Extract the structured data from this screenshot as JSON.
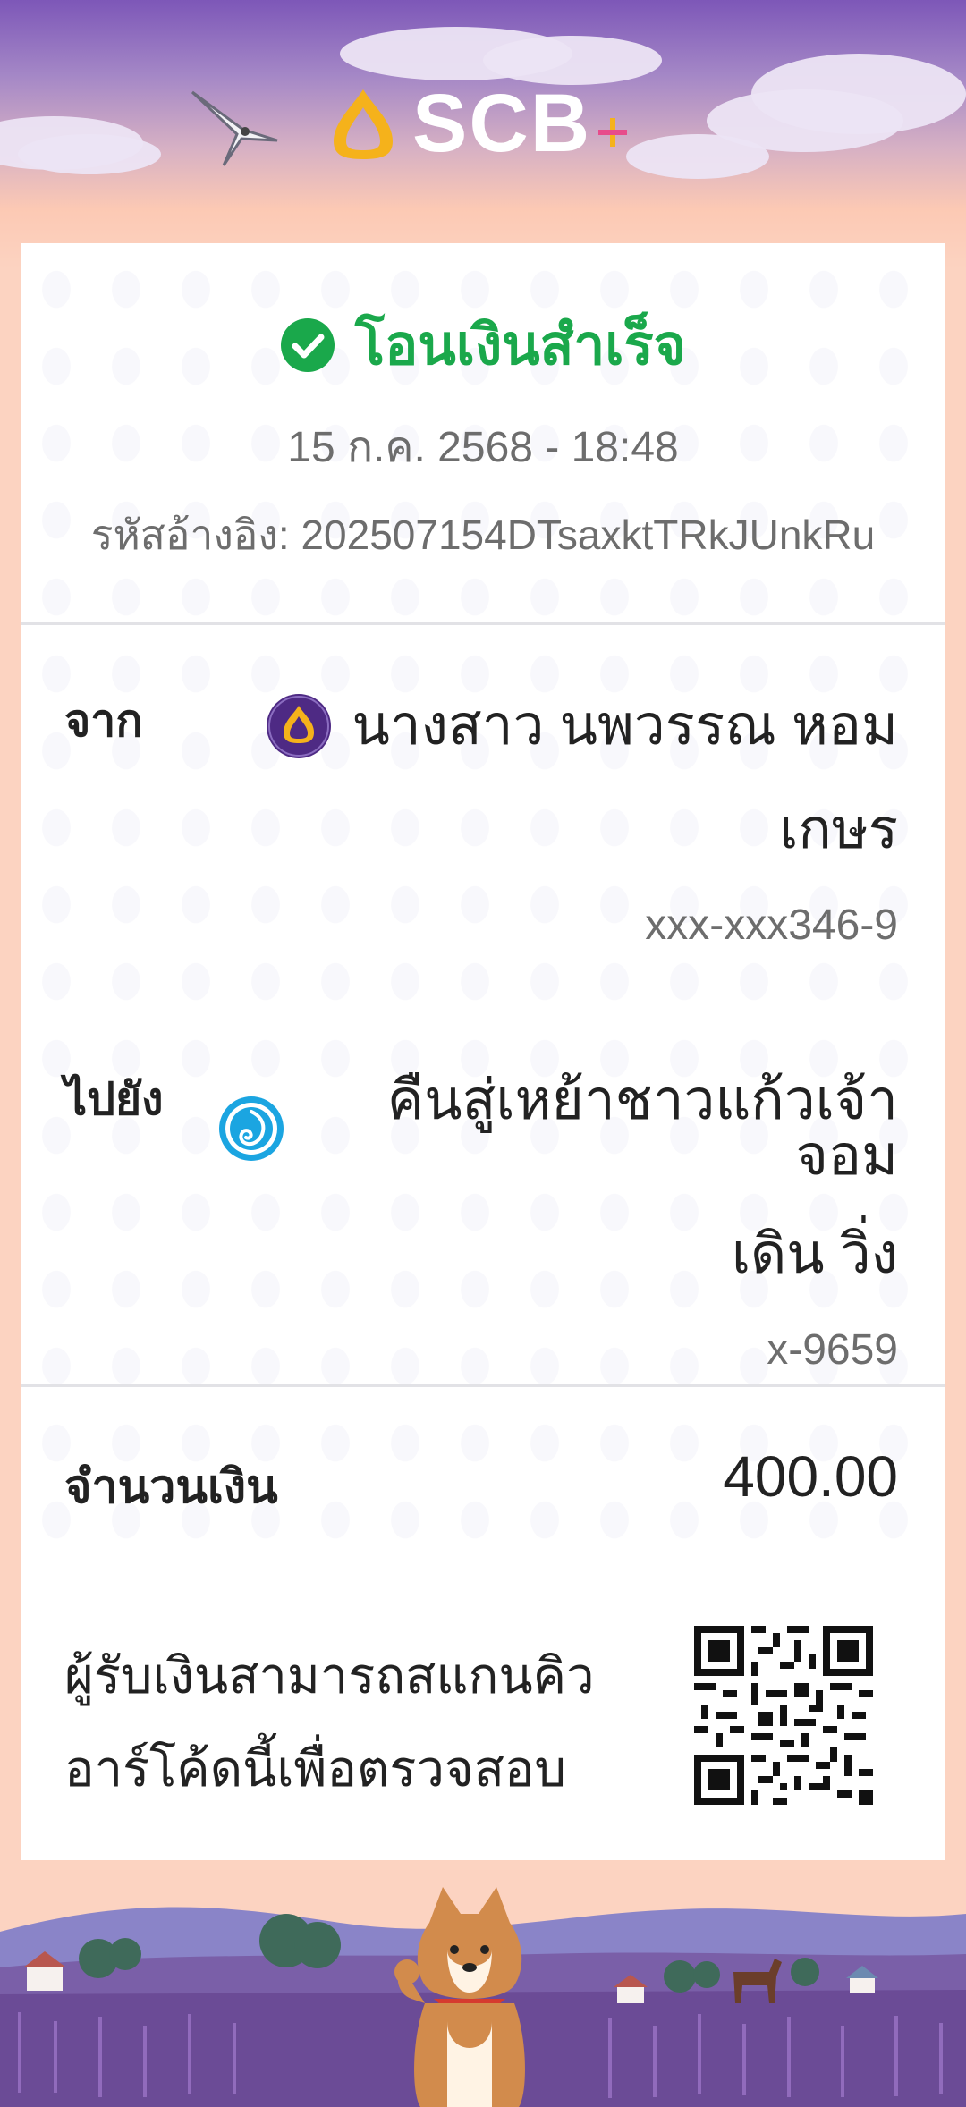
{
  "header": {
    "brand": "SCB"
  },
  "receipt": {
    "status": "โอนเงินสำเร็จ",
    "datetime": "15 ก.ค. 2568 - 18:48",
    "ref_label": "รหัสอ้างอิง:",
    "ref_value": "202507154DTsaxktTRkJUnkRu"
  },
  "from": {
    "label": "จาก",
    "name_line1": "นางสาว นพวรรณ หอม",
    "name_line2": "เกษร",
    "account": "xxx-xxx346-9",
    "bank_icon": "scb-bank-icon"
  },
  "to": {
    "label": "ไปยัง",
    "name_line1": "คืนสู่เหย้าชาวแก้วเจ้าจอม",
    "name_line2": "เดิน วิ่ง",
    "account": "x-9659",
    "bank_icon": "krungthai-bank-icon"
  },
  "amount": {
    "label": "จำนวนเงิน",
    "value": "400.00"
  },
  "verify": {
    "line1": "ผู้รับเงินสามารถสแกนคิว",
    "line2": "อาร์โค้ดนี้เพื่อตรวจสอบ"
  },
  "colors": {
    "success": "#1aa84b",
    "scb_purple": "#4e2a84",
    "scb_gold": "#f5b21b",
    "background_peach": "#fcd3c1"
  }
}
